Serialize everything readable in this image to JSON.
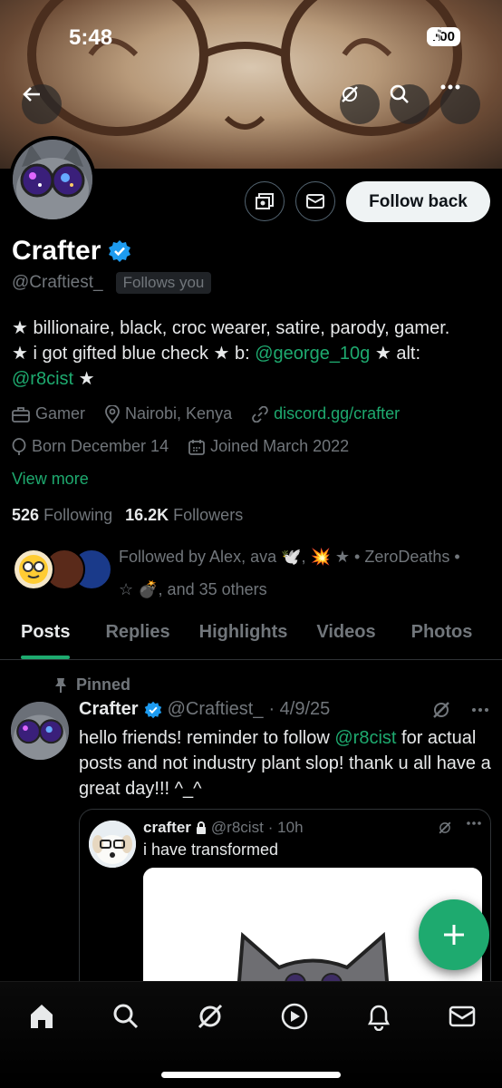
{
  "status": {
    "time": "5:48",
    "battery": "100"
  },
  "profile": {
    "name": "Crafter",
    "handle": "@Craftiest_",
    "follows_you": "Follows you",
    "follow_button": "Follow back",
    "bio": {
      "line1": "★ billionaire, black, croc wearer, satire, parody, gamer.",
      "line2_a": "★ i got gifted blue check ★ b: ",
      "line2_link": "@george_10g",
      "line2_b": " ★ alt:",
      "line3_link": "@r8cist",
      "line3_b": " ★"
    },
    "category": "Gamer",
    "location": "Nairobi, Kenya",
    "website": "discord.gg/crafter",
    "birthday": "Born December 14",
    "joined": "Joined March 2022",
    "view_more": "View more",
    "following_count": "526",
    "following_label": "Following",
    "followers_count": "16.2K",
    "followers_label": "Followers",
    "followed_by_1": "Followed by Alex, ava 🕊️, 💥 ★ • ZeroDeaths •",
    "followed_by_2": "☆ 💣, and 35 others"
  },
  "tabs": [
    "Posts",
    "Replies",
    "Highlights",
    "Videos",
    "Photos"
  ],
  "post": {
    "pinned_label": "Pinned",
    "name": "Crafter",
    "handle": "@Craftiest_",
    "date": "· 4/9/25",
    "text_a": "hello friends! reminder to follow ",
    "text_link": "@r8cist",
    "text_b": " for actual posts and not industry plant slop! thank u all have a great day!!! ^_^",
    "quote": {
      "name": "crafter",
      "handle": "@r8cist",
      "time": "· 10h",
      "text": "i have transformed"
    }
  },
  "colors": {
    "accent": "#1eaa6f",
    "verified": "#1d9bf0",
    "muted": "#71767b"
  },
  "nav": [
    "home-icon",
    "search-icon",
    "grok-icon",
    "video-icon",
    "notifications-icon",
    "messages-icon"
  ]
}
